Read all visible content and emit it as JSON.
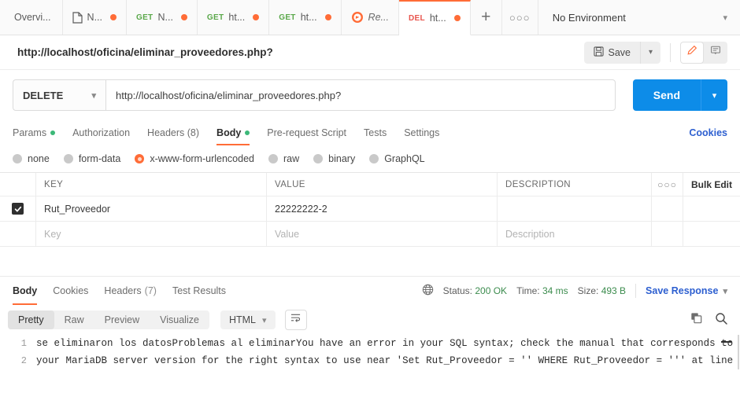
{
  "tabbar": {
    "tabs": [
      {
        "label": "Overvi...",
        "method": "",
        "icon": "",
        "unsaved": false,
        "active": false,
        "italic": false
      },
      {
        "label": "N...",
        "method": "",
        "icon": "document-icon",
        "unsaved": true,
        "active": false,
        "italic": false
      },
      {
        "label": "N...",
        "method": "GET",
        "icon": "",
        "unsaved": true,
        "active": false,
        "italic": false
      },
      {
        "label": "ht...",
        "method": "GET",
        "icon": "",
        "unsaved": true,
        "active": false,
        "italic": false
      },
      {
        "label": "ht...",
        "method": "GET",
        "icon": "",
        "unsaved": true,
        "active": false,
        "italic": false
      },
      {
        "label": "Re...",
        "method": "",
        "icon": "runner-icon",
        "unsaved": false,
        "active": false,
        "italic": true
      },
      {
        "label": "ht...",
        "method": "DEL",
        "icon": "",
        "unsaved": true,
        "active": true,
        "italic": false
      }
    ],
    "new_tab_label": "+",
    "more_label": "○○○",
    "environment": "No Environment"
  },
  "titlebar": {
    "request_title": "http://localhost/oficina/eliminar_proveedores.php?",
    "save_label": "Save"
  },
  "urlbar": {
    "method": "DELETE",
    "url": "http://localhost/oficina/eliminar_proveedores.php?",
    "send_label": "Send"
  },
  "request_tabs": {
    "items": [
      {
        "label": "Params",
        "dot": true,
        "active": false
      },
      {
        "label": "Authorization",
        "dot": false,
        "active": false
      },
      {
        "label": "Headers (8)",
        "dot": false,
        "active": false
      },
      {
        "label": "Body",
        "dot": true,
        "active": true
      },
      {
        "label": "Pre-request Script",
        "dot": false,
        "active": false
      },
      {
        "label": "Tests",
        "dot": false,
        "active": false
      },
      {
        "label": "Settings",
        "dot": false,
        "active": false
      }
    ],
    "cookies_label": "Cookies"
  },
  "body_types": [
    {
      "label": "none",
      "selected": false
    },
    {
      "label": "form-data",
      "selected": false
    },
    {
      "label": "x-www-form-urlencoded",
      "selected": true
    },
    {
      "label": "raw",
      "selected": false
    },
    {
      "label": "binary",
      "selected": false
    },
    {
      "label": "GraphQL",
      "selected": false
    }
  ],
  "kv_table": {
    "headers": {
      "key": "KEY",
      "value": "VALUE",
      "description": "DESCRIPTION",
      "more": "○○○",
      "bulk_edit": "Bulk Edit"
    },
    "rows": [
      {
        "checked": true,
        "key": "Rut_Proveedor",
        "value": "22222222-2",
        "description": ""
      }
    ],
    "placeholder_row": {
      "key": "Key",
      "value": "Value",
      "description": "Description"
    }
  },
  "response": {
    "tabs": [
      {
        "label": "Body",
        "count": "",
        "active": true
      },
      {
        "label": "Cookies",
        "count": "",
        "active": false
      },
      {
        "label": "Headers",
        "count": "(7)",
        "active": false
      },
      {
        "label": "Test Results",
        "count": "",
        "active": false
      }
    ],
    "status_label": "Status:",
    "status_value": "200 OK",
    "time_label": "Time:",
    "time_value": "34 ms",
    "size_label": "Size:",
    "size_value": "493 B",
    "save_response_label": "Save Response",
    "view_modes": [
      {
        "label": "Pretty",
        "active": true
      },
      {
        "label": "Raw",
        "active": false
      },
      {
        "label": "Preview",
        "active": false
      },
      {
        "label": "Visualize",
        "active": false
      }
    ],
    "format": "HTML",
    "lines": [
      {
        "num": "1",
        "text": "se eliminaron los datosProblemas al eliminarYou have an error in your SQL syntax; check the manual that corresponds to"
      },
      {
        "num": "2",
        "text": "your MariaDB server version for the right syntax to use near 'Set Rut_Proveedor = '' WHERE Rut_Proveedor = ''' at line"
      }
    ]
  },
  "colors": {
    "accent": "#ff6c37",
    "send_blue": "#0d8ce8",
    "link_blue": "#2d5fd0",
    "status_green": "#3c8c4e",
    "get_green": "#5aa84a",
    "delete_red": "#e8554d"
  }
}
